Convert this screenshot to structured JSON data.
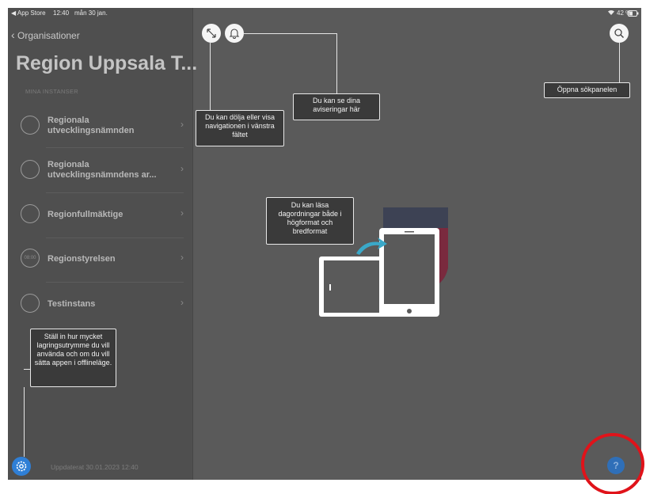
{
  "status_bar": {
    "back_app": "◀ App Store",
    "time": "12:40",
    "date": "mån 30 jan.",
    "battery": "42 %"
  },
  "sidebar": {
    "back_label": "Organisationer",
    "title": "Region Uppsala T...",
    "section_header": "MINA INSTANSER",
    "items": [
      {
        "label": "Regionala utvecklingsnämnden",
        "badge": ""
      },
      {
        "label": "Regionala utvecklingsnämndens ar...",
        "badge": ""
      },
      {
        "label": "Regionfullmäktige",
        "badge": ""
      },
      {
        "label": "Regionstyrelsen",
        "badge": "08:00"
      },
      {
        "label": "Testinstans",
        "badge": ""
      }
    ],
    "updated_text": "Uppdaterat 30.01.2023 12:40"
  },
  "callouts": {
    "nav_toggle": "Du kan dölja eller visa navigationen i vänstra fältet",
    "notifications": "Du kan se dina aviseringar här",
    "search": "Öppna sökpanelen",
    "orientation": "Du kan läsa dagordningar både i högformat och bredformat",
    "storage": "Ställ in hur mycket lagringsutrymme du vill använda och om du vill sätta appen i offlineläge."
  },
  "help_button": {
    "label": "?"
  },
  "icons": {
    "expand": "expand-arrows-icon",
    "bell": "bell-icon",
    "search": "search-icon",
    "settings": "gear-icon",
    "wifi": "wifi-icon",
    "battery": "battery-icon",
    "help": "question-icon"
  },
  "colors": {
    "overlay_bg": "#5a5a5a",
    "sidebar_bg": "#4f4f4f",
    "accent_blue": "#2f7fd6",
    "highlight_red": "#e0131a",
    "logo_dark": "#3d4254",
    "logo_red": "#7a2a3e",
    "arrow_teal": "#3aa8c8"
  }
}
